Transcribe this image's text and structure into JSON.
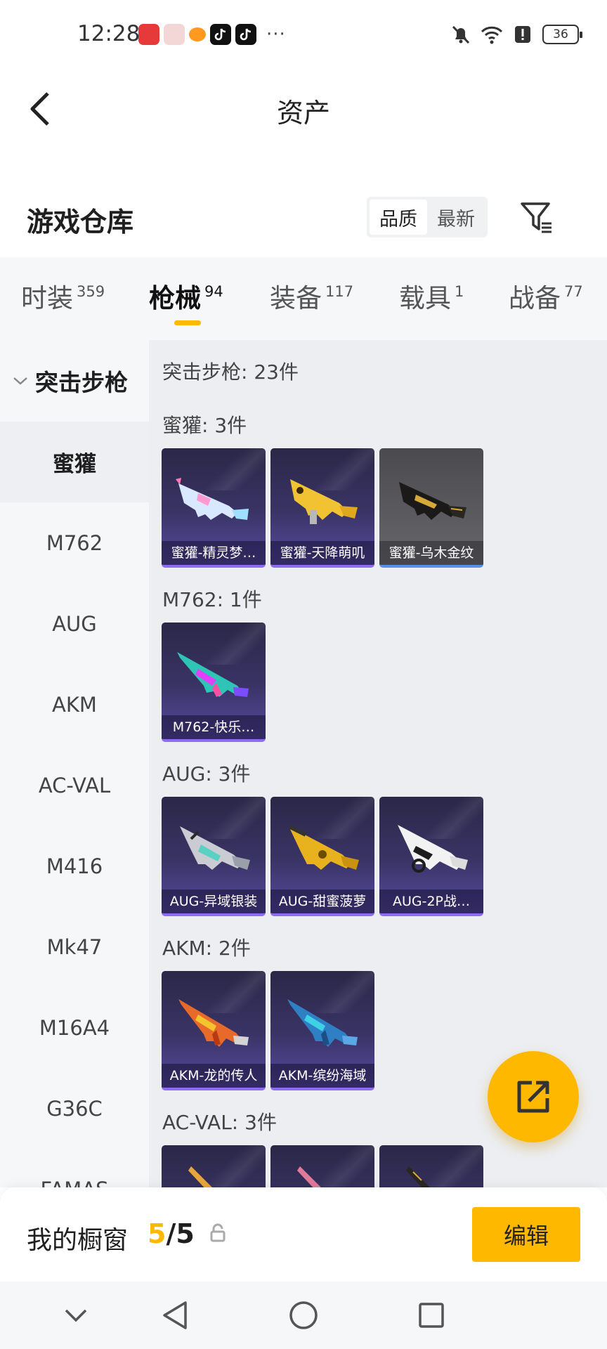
{
  "status_bar": {
    "time": "12:28",
    "battery": "36",
    "dots": "···",
    "app_icons": [
      "huawei-app-icon",
      "gift-box-icon",
      "taobao-icon",
      "tiktok-icon",
      "tiktok-icon"
    ]
  },
  "header": {
    "title": "资产"
  },
  "warehouse": {
    "title": "游戏仓库",
    "sort_options": [
      "品质",
      "最新"
    ],
    "sort_active": "品质"
  },
  "tabs": [
    {
      "label": "时装",
      "count": "359"
    },
    {
      "label": "枪械",
      "count": "94"
    },
    {
      "label": "装备",
      "count": "117"
    },
    {
      "label": "载具",
      "count": "1"
    },
    {
      "label": "战备",
      "count": "77"
    }
  ],
  "active_tab": "枪械",
  "sidebar": {
    "group": "突击步枪",
    "items": [
      "蜜獾",
      "M762",
      "AUG",
      "AKM",
      "AC-VAL",
      "M416",
      "Mk47",
      "M16A4",
      "G36C",
      "FAMAS"
    ],
    "active_item": "蜜獾"
  },
  "content": {
    "summary": "突击步枪: 23件",
    "sections": [
      {
        "title": "蜜獾: 3件",
        "items": [
          "蜜獾-精灵梦…",
          "蜜獾-天降萌叽",
          "蜜獾-乌木金纹"
        ]
      },
      {
        "title": "M762: 1件",
        "items": [
          "M762-快乐…"
        ]
      },
      {
        "title": "AUG: 3件",
        "items": [
          "AUG-异域银装",
          "AUG-甜蜜菠萝",
          "AUG-2P战…"
        ]
      },
      {
        "title": "AKM: 2件",
        "items": [
          "AKM-龙的传人",
          "AKM-缤纷海域"
        ]
      },
      {
        "title": "AC-VAL: 3件",
        "items": [
          "",
          "",
          ""
        ]
      }
    ]
  },
  "showcase": {
    "label": "我的橱窗",
    "count_current": "5",
    "count_sep_total": "/5",
    "edit_label": "编辑"
  },
  "colors": {
    "accent": "#ffb800",
    "card_purple": "#3a3466",
    "card_grey": "#5b5b60"
  }
}
